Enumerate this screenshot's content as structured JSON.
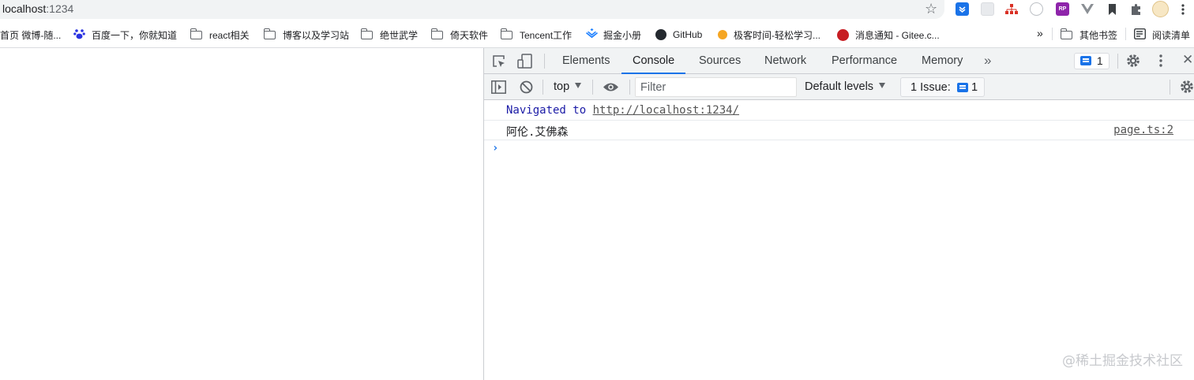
{
  "browser": {
    "url_host": "localhost",
    "url_port": ":1234",
    "bookmarks": [
      {
        "label": "首页 微博-随...",
        "icon": "weibo-icon"
      },
      {
        "label": "百度一下，你就知道",
        "icon": "baidu-paw-icon"
      },
      {
        "label": "react相关",
        "icon": "folder-icon"
      },
      {
        "label": "博客以及学习站",
        "icon": "folder-icon"
      },
      {
        "label": "绝世武学",
        "icon": "folder-icon"
      },
      {
        "label": "倚天软件",
        "icon": "folder-icon"
      },
      {
        "label": "Tencent工作",
        "icon": "folder-icon"
      },
      {
        "label": "掘金小册",
        "icon": "juejin-icon"
      },
      {
        "label": "GitHub",
        "icon": "github-icon"
      },
      {
        "label": "极客时间-轻松学习...",
        "icon": "geektime-icon"
      },
      {
        "label": "消息通知 - Gitee.c...",
        "icon": "gitee-icon"
      }
    ],
    "overflow_label": "»",
    "other_bookmarks": "其他书签",
    "reading_list": "阅读清单"
  },
  "devtools": {
    "tabs": [
      "Elements",
      "Console",
      "Sources",
      "Network",
      "Performance",
      "Memory"
    ],
    "active_tab": "Console",
    "more_tabs": "»",
    "issues_badge_count": "1",
    "close_glyph": "✕",
    "toolbar": {
      "context": "top",
      "filter_placeholder": "Filter",
      "levels": "Default levels",
      "issues_label": "1 Issue:",
      "issues_count": "1"
    },
    "console": {
      "nav_prefix": "Navigated to",
      "nav_url": "http://localhost:1234/",
      "log_text": "阿伦.艾佛森",
      "log_source": "page.ts:2",
      "prompt": "›"
    }
  },
  "watermark": "@稀土掘金技术社区",
  "colors": {
    "accent": "#1a73e8",
    "nav_text": "#1a1aa6",
    "toolbar_bg": "#f1f3f4",
    "border": "#cbcdd1"
  }
}
